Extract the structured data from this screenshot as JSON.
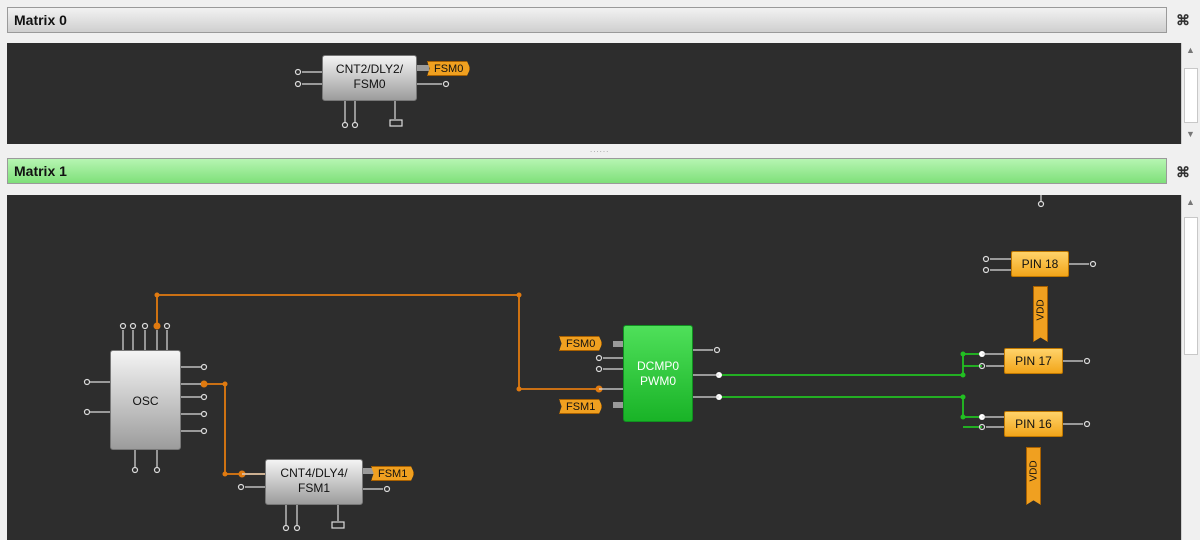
{
  "matrix0": {
    "title": "Matrix 0",
    "block_label_line1": "CNT2/DLY2/",
    "block_label_line2": "FSM0",
    "output_tag": "FSM0"
  },
  "matrix1": {
    "title": "Matrix 1",
    "osc_label": "OSC",
    "cnt_label_line1": "CNT4/DLY4/",
    "cnt_label_line2": "FSM1",
    "cnt_output_tag": "FSM1",
    "dcmp_label_line1": "DCMP0",
    "dcmp_label_line2": "PWM0",
    "dcmp_in_tag_a": "FSM0",
    "dcmp_in_tag_b": "FSM1",
    "pin18": "PIN 18",
    "pin17": "PIN 17",
    "pin16": "PIN 16",
    "vdd_a": "VDD",
    "vdd_b": "VDD"
  },
  "icons": [
    "collapse-icon",
    "scroll-up-arrow-icon",
    "scroll-down-arrow-icon"
  ],
  "colors": {
    "canvas": "#2d2d2d",
    "wire_orange": "#e07a10",
    "wire_green": "#22c022",
    "header_active": "#7fe07a"
  }
}
